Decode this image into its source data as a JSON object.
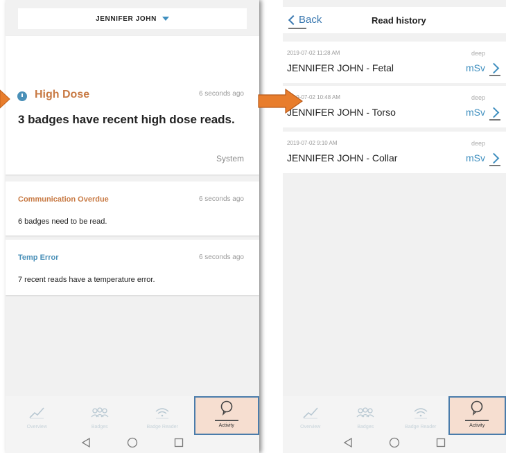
{
  "left_screen": {
    "header": {
      "user_name": "JENNIFER JOHN"
    },
    "alert_primary": {
      "title": "High Dose",
      "time": "6 seconds ago",
      "message": "3 badges have recent high dose reads.",
      "source": "System"
    },
    "alerts": [
      {
        "title": "Communication Overdue",
        "time": "6 seconds ago",
        "message": "6 badges need to be read."
      },
      {
        "title": "Temp Error",
        "time": "6 seconds ago",
        "message": "7 recent reads have a temperature error."
      }
    ],
    "nav": [
      {
        "label": "Overview",
        "icon": "chart-line-icon"
      },
      {
        "label": "Badges",
        "icon": "people-group-icon"
      },
      {
        "label": "Badge Reader",
        "icon": "wifi-icon"
      },
      {
        "label": "Activity",
        "icon": "speech-bubble-icon"
      }
    ]
  },
  "right_screen": {
    "header": {
      "back_label": "Back",
      "title": "Read history"
    },
    "reads": [
      {
        "date": "2019-07-02 11:28 AM",
        "name": "JENNIFER JOHN - Fetal",
        "depth": "deep",
        "unit": "mSv"
      },
      {
        "date": "2019-07-02 10:48 AM",
        "name": "JENNIFER JOHN - Torso",
        "depth": "deep",
        "unit": "mSv"
      },
      {
        "date": "2019-07-02 9:10 AM",
        "name": "JENNIFER JOHN - Collar",
        "depth": "deep",
        "unit": "mSv"
      }
    ],
    "nav": [
      {
        "label": "Overview",
        "icon": "chart-line-icon"
      },
      {
        "label": "Badges",
        "icon": "people-group-icon"
      },
      {
        "label": "Badge Reader",
        "icon": "wifi-icon"
      },
      {
        "label": "Activity",
        "icon": "speech-bubble-icon"
      }
    ]
  },
  "colors": {
    "accent_blue": "#4a90b8",
    "alert_orange": "#c87a44",
    "callout_arrow": "#e87d2c",
    "active_nav_bg": "#f6ded0"
  }
}
